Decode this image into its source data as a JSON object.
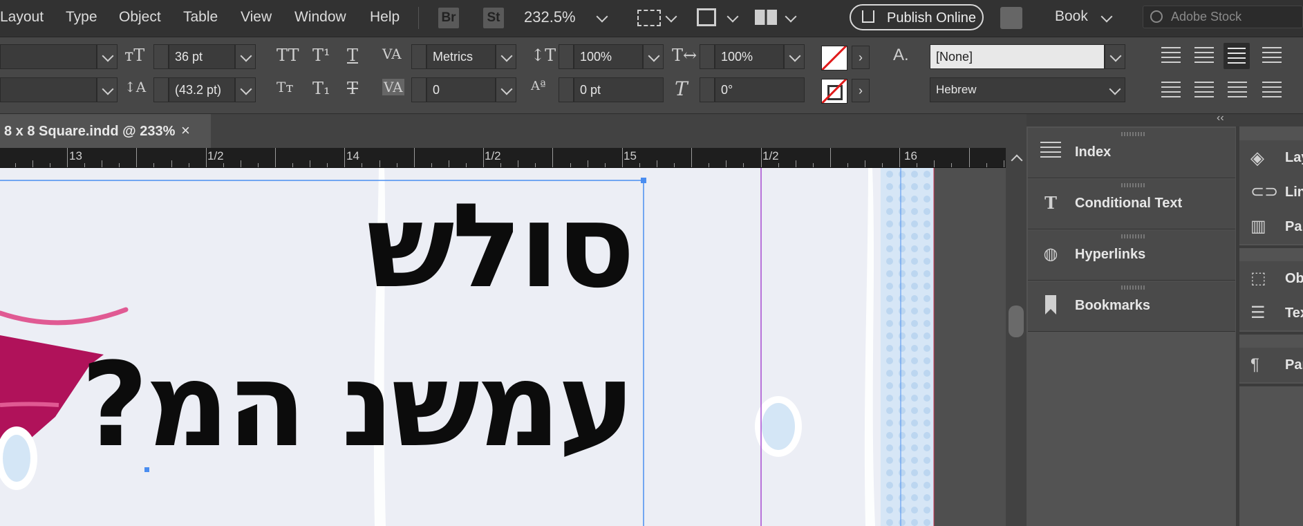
{
  "menu": {
    "items": [
      "Layout",
      "Type",
      "Object",
      "Table",
      "View",
      "Window",
      "Help"
    ],
    "bridge_label": "Br",
    "stock_label": "St",
    "zoom": "232.5%",
    "publish_label": "Publish Online",
    "workspace": "Book",
    "search_placeholder": "Adobe Stock"
  },
  "control": {
    "font_size": "36 pt",
    "leading": "(43.2 pt)",
    "kerning": "Metrics",
    "tracking": "0",
    "vertical_scale": "100%",
    "horizontal_scale": "100%",
    "baseline_shift": "0 pt",
    "skew": "0°",
    "char_style": "[None]",
    "language": "Hebrew"
  },
  "tab": {
    "title": "8 x 8 Square.indd @ 233%",
    "close": "×"
  },
  "ruler": {
    "labels": [
      "13",
      "1/2",
      "14",
      "1/2",
      "15",
      "1/2",
      "16"
    ]
  },
  "panels": {
    "left": [
      "Index",
      "Conditional Text",
      "Hyperlinks",
      "Bookmarks"
    ],
    "right": [
      "Lay",
      "Lin",
      "Pa",
      "Ob",
      "Tex",
      "Par"
    ],
    "collapse": "‹‹"
  },
  "document": {
    "line1": "סולש",
    "line2": "עמשנ המ?"
  },
  "colors": {
    "accent_blue": "#4a8df0",
    "guide_purple": "#a64ad0",
    "magenta_shape": "#b0125a",
    "pink_stroke": "#e05a93"
  }
}
